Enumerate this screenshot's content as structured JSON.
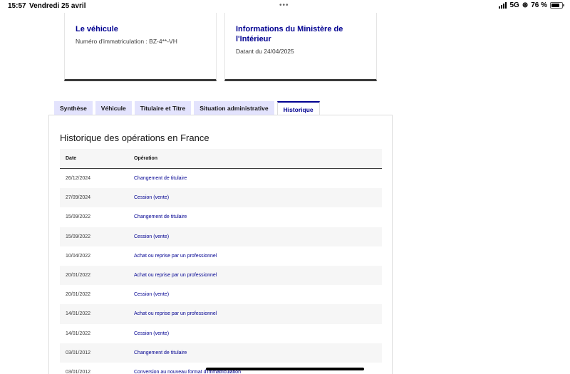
{
  "status_bar": {
    "time": "15:57",
    "date": "Vendredi 25 avril",
    "dots": "•••",
    "network": "5G",
    "battery": "76 %",
    "battery_level": 0.76
  },
  "cards": [
    {
      "title": "Le véhicule",
      "subtitle": "Numéro d'immatriculation : BZ-4**-VH"
    },
    {
      "title": "Informations du Ministère de l'Intérieur",
      "subtitle": "Datant du 24/04/2025"
    }
  ],
  "tabs": [
    {
      "label": "Synthèse",
      "active": false
    },
    {
      "label": "Véhicule",
      "active": false
    },
    {
      "label": "Titulaire et Titre",
      "active": false
    },
    {
      "label": "Situation administrative",
      "active": false
    },
    {
      "label": "Historique",
      "active": true
    }
  ],
  "history": {
    "title": "Historique des opérations en France",
    "columns": {
      "date": "Date",
      "operation": "Opération"
    },
    "rows": [
      {
        "date": "26/12/2024",
        "operation": "Changement de titulaire"
      },
      {
        "date": "27/09/2024",
        "operation": "Cession (vente)"
      },
      {
        "date": "15/09/2022",
        "operation": "Changement de titulaire"
      },
      {
        "date": "15/09/2022",
        "operation": "Cession (vente)"
      },
      {
        "date": "10/04/2022",
        "operation": "Achat ou reprise par un professionnel"
      },
      {
        "date": "20/01/2022",
        "operation": "Achat ou reprise par un professionnel"
      },
      {
        "date": "20/01/2022",
        "operation": "Cession (vente)"
      },
      {
        "date": "14/01/2022",
        "operation": "Achat ou reprise par un professionnel"
      },
      {
        "date": "14/01/2022",
        "operation": "Cession (vente)"
      },
      {
        "date": "03/01/2012",
        "operation": "Changement de titulaire"
      },
      {
        "date": "03/01/2012",
        "operation": "Conversion au nouveau format d'immatriculation"
      }
    ]
  },
  "colors": {
    "accent": "#000091",
    "tab_bg": "#e3e3fd",
    "row_alt": "#f6f6f6"
  }
}
